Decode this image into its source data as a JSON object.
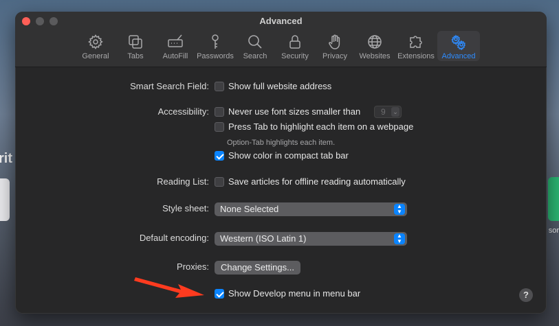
{
  "background": {
    "left_text": "rit",
    "right_text": "sor"
  },
  "window": {
    "title": "Advanced"
  },
  "toolbar": {
    "items": [
      {
        "label": "General",
        "icon": "gear-icon"
      },
      {
        "label": "Tabs",
        "icon": "tabs-icon"
      },
      {
        "label": "AutoFill",
        "icon": "autofill-icon"
      },
      {
        "label": "Passwords",
        "icon": "key-icon"
      },
      {
        "label": "Search",
        "icon": "search-icon"
      },
      {
        "label": "Security",
        "icon": "lock-icon"
      },
      {
        "label": "Privacy",
        "icon": "hand-icon"
      },
      {
        "label": "Websites",
        "icon": "globe-icon"
      },
      {
        "label": "Extensions",
        "icon": "puzzle-icon"
      },
      {
        "label": "Advanced",
        "icon": "gears-icon",
        "active": true
      }
    ]
  },
  "settings": {
    "smart_search": {
      "label": "Smart Search Field:",
      "option": "Show full website address",
      "checked": false
    },
    "accessibility": {
      "label": "Accessibility:",
      "font_option": "Never use font sizes smaller than",
      "font_value": "9",
      "tab_option": "Press Tab to highlight each item on a webpage",
      "tab_hint": "Option-Tab highlights each item.",
      "color_option": "Show color in compact tab bar"
    },
    "reading_list": {
      "label": "Reading List:",
      "option": "Save articles for offline reading automatically"
    },
    "style_sheet": {
      "label": "Style sheet:",
      "value": "None Selected"
    },
    "encoding": {
      "label": "Default encoding:",
      "value": "Western (ISO Latin 1)"
    },
    "proxies": {
      "label": "Proxies:",
      "button": "Change Settings..."
    },
    "develop": {
      "option": "Show Develop menu in menu bar",
      "checked": true
    }
  },
  "help": {
    "label": "?"
  },
  "colors": {
    "accent": "#0a84ff",
    "annotation_arrow": "#ff3b1f"
  }
}
